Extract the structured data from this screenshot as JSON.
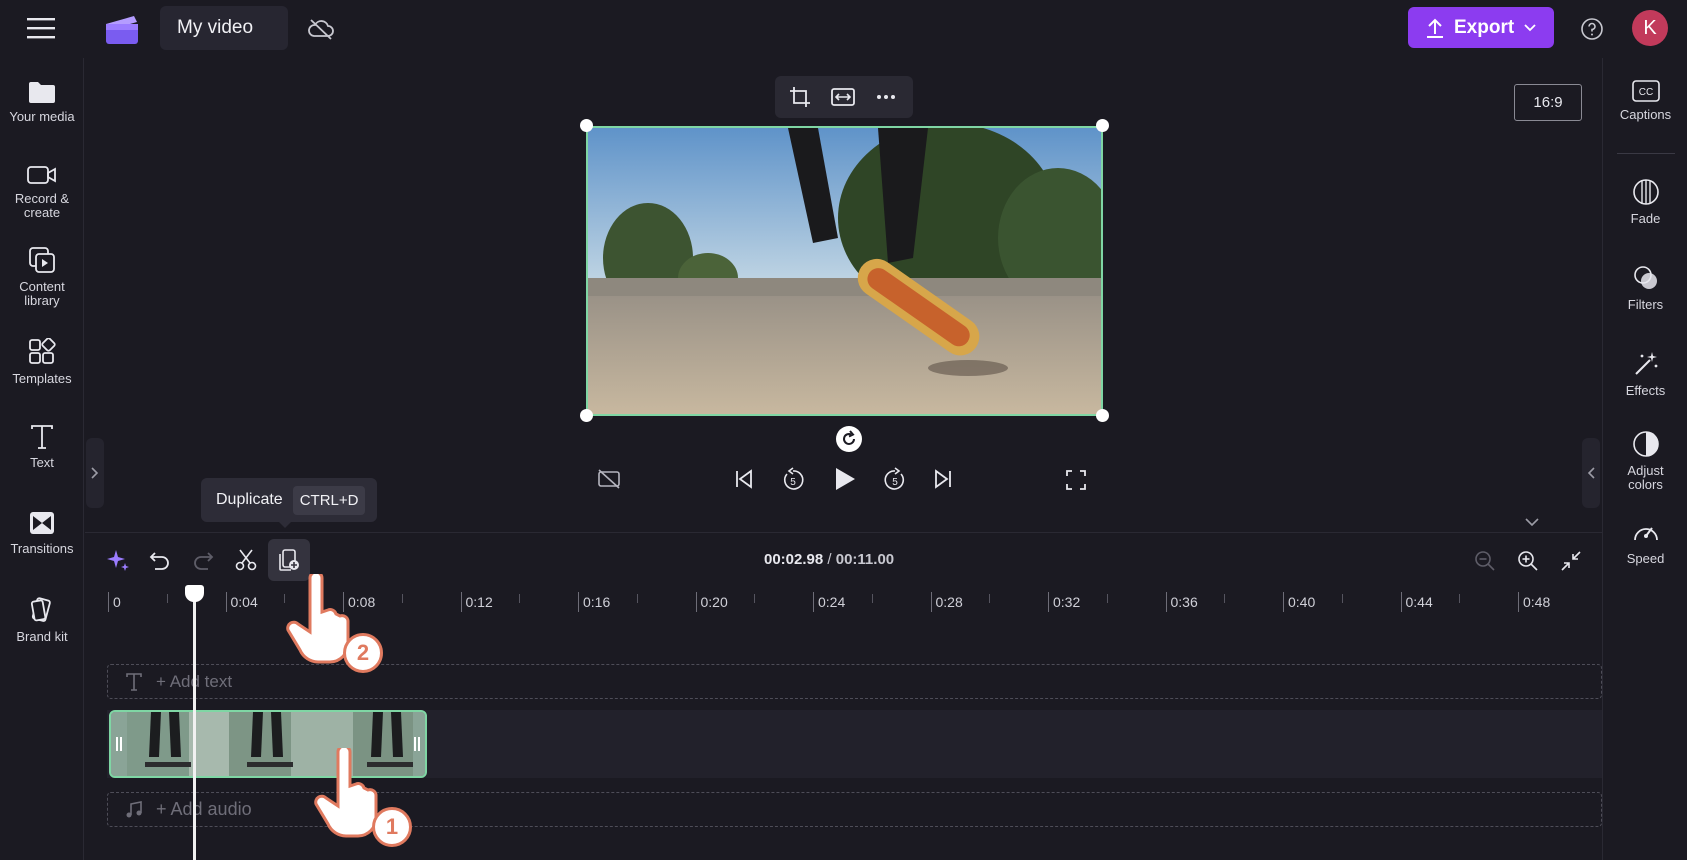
{
  "app": {
    "project_title": "My video",
    "export_label": "Export",
    "avatar_initial": "K",
    "accent_color": "#8c3cf0",
    "selection_color": "#7fd6a4"
  },
  "left_sidebar": {
    "items": [
      {
        "label": "Your media",
        "icon": "folder-icon"
      },
      {
        "label": "Record &\ncreate",
        "icon": "camera-icon"
      },
      {
        "label": "Content\nlibrary",
        "icon": "content-library-icon"
      },
      {
        "label": "Templates",
        "icon": "templates-icon"
      },
      {
        "label": "Text",
        "icon": "text-icon"
      },
      {
        "label": "Transitions",
        "icon": "transitions-icon"
      },
      {
        "label": "Brand kit",
        "icon": "brand-kit-icon"
      }
    ]
  },
  "right_sidebar": {
    "items": [
      {
        "label": "Captions",
        "icon": "captions-icon"
      },
      {
        "label": "Fade",
        "icon": "fade-icon"
      },
      {
        "label": "Filters",
        "icon": "filters-icon"
      },
      {
        "label": "Effects",
        "icon": "effects-icon"
      },
      {
        "label": "Adjust\ncolors",
        "icon": "adjust-colors-icon"
      },
      {
        "label": "Speed",
        "icon": "speed-icon"
      }
    ]
  },
  "preview": {
    "aspect_ratio": "16:9"
  },
  "tooltip": {
    "label": "Duplicate",
    "shortcut": "CTRL+D"
  },
  "timeline": {
    "current_time": "00:02.98",
    "separator": " / ",
    "total_time": "00:11.00",
    "ruler_labels": [
      "0",
      "0:04",
      "0:08",
      "0:12",
      "0:16",
      "0:20",
      "0:24",
      "0:28",
      "0:32",
      "0:36",
      "0:40",
      "0:44",
      "0:48"
    ],
    "text_track_label": "+ Add text",
    "audio_track_label": "+ Add audio",
    "playhead_seconds": 2.98
  },
  "annotations": {
    "step1": "1",
    "step2": "2"
  }
}
